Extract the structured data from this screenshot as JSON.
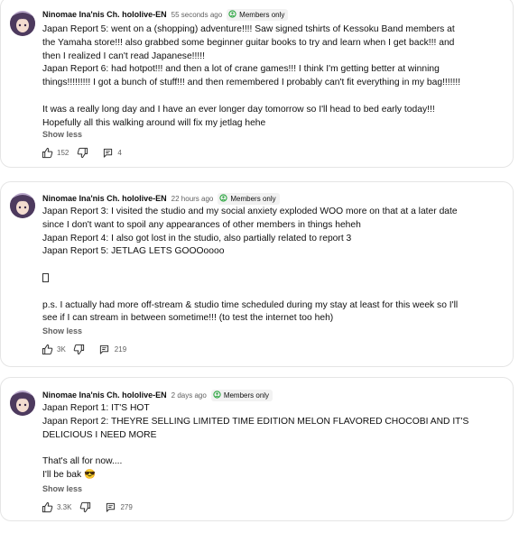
{
  "comments": [
    {
      "author": "Ninomae Ina'nis Ch. hololive-EN",
      "time": "55 seconds ago",
      "badge": "Members only",
      "lines": [
        "Japan Report 5: went on a (shopping) adventure!!!! Saw signed tshirts of Kessoku Band members at",
        "the Yamaha store!!! also grabbed some beginner guitar books to try and learn when I get back!!! and",
        "then I realized I can't read Japanese!!!!!",
        "Japan Report 6: had hotpot!!! and then a lot of crane games!!! I think I'm getting better at winning",
        "things!!!!!!!!! I got a bunch of stuff!!! and then remembered I probably can't fit everything in my bag!!!!!!!",
        "",
        "It was a really long day and I have an ever longer day tomorrow so I'll head to bed early today!!!",
        "Hopefully all this walking around will fix my jetlag hehe"
      ],
      "show_less": "Show less",
      "likes": "152",
      "replies": "4"
    },
    {
      "author": "Ninomae Ina'nis Ch. hololive-EN",
      "time": "22 hours ago",
      "badge": "Members only",
      "lines": [
        "Japan Report 3: I visited the studio and my social anxiety exploded WOO more on that at a later date",
        "since I don't want to spoil any appearances of other members in things heheh",
        "Japan Report 4: I also got lost in the studio, also partially related to report 3",
        "Japan Report 5: JETLAG LETS GOOOoooo",
        "",
        "",
        "",
        "p.s. I actually had more off-stream & studio time scheduled during my stay at least for this week so I'll",
        "see if I can stream in between sometime!!! (to test the internet too heh)"
      ],
      "show_less": "Show less",
      "likes": "3K",
      "replies": "219"
    },
    {
      "author": "Ninomae Ina'nis Ch. hololive-EN",
      "time": "2 days ago",
      "badge": "Members only",
      "lines": [
        "Japan Report 1: IT'S HOT",
        "Japan Report 2: THEYRE SELLING LIMITED TIME EDITION MELON FLAVORED CHOCOBI AND IT'S",
        "DELICIOUS I NEED MORE",
        "",
        "That's all for now....",
        "I'll be bak 😎"
      ],
      "show_less": "Show less",
      "likes": "3.3K",
      "replies": "279"
    }
  ]
}
